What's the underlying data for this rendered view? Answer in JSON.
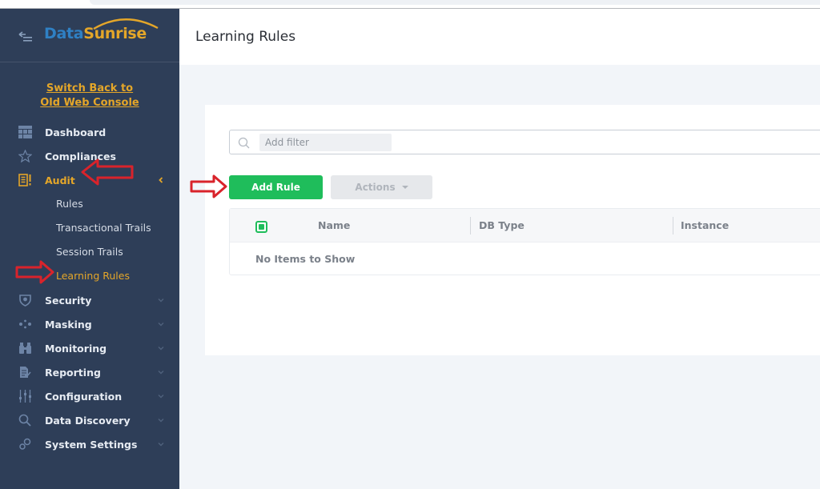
{
  "app": {
    "logo_part1": "Data",
    "logo_part2": "Sunrise",
    "switch_link_line1": "Switch Back to",
    "switch_link_line2": "Old Web Console"
  },
  "sidebar": {
    "items": [
      {
        "label": "Dashboard",
        "icon": "dashboard-icon",
        "active": false
      },
      {
        "label": "Compliances",
        "icon": "star-icon",
        "active": false
      },
      {
        "label": "Audit",
        "icon": "audit-icon",
        "active": true,
        "expanded": true,
        "children": [
          {
            "label": "Rules",
            "active": false
          },
          {
            "label": "Transactional Trails",
            "active": false
          },
          {
            "label": "Session Trails",
            "active": false
          },
          {
            "label": "Learning Rules",
            "active": true
          }
        ]
      },
      {
        "label": "Security",
        "icon": "shield-icon",
        "active": false
      },
      {
        "label": "Masking",
        "icon": "masking-icon",
        "active": false
      },
      {
        "label": "Monitoring",
        "icon": "binoculars-icon",
        "active": false
      },
      {
        "label": "Reporting",
        "icon": "report-icon",
        "active": false
      },
      {
        "label": "Configuration",
        "icon": "sliders-icon",
        "active": false
      },
      {
        "label": "Data Discovery",
        "icon": "search-icon",
        "active": false
      },
      {
        "label": "System Settings",
        "icon": "gears-icon",
        "active": false
      }
    ]
  },
  "header": {
    "title": "Learning Rules"
  },
  "filter": {
    "placeholder": "Add filter",
    "value": ""
  },
  "toolbar": {
    "add_rule_label": "Add Rule",
    "actions_label": "Actions"
  },
  "table": {
    "columns": [
      "Name",
      "DB Type",
      "Instance"
    ],
    "rows": [],
    "empty_message": "No Items to Show"
  },
  "colors": {
    "sidebar_bg": "#2e3e58",
    "accent_orange": "#e4a629",
    "logo_blue": "#2f80c4",
    "primary_green": "#1fbd5b",
    "annotation_red": "#d9232b"
  }
}
